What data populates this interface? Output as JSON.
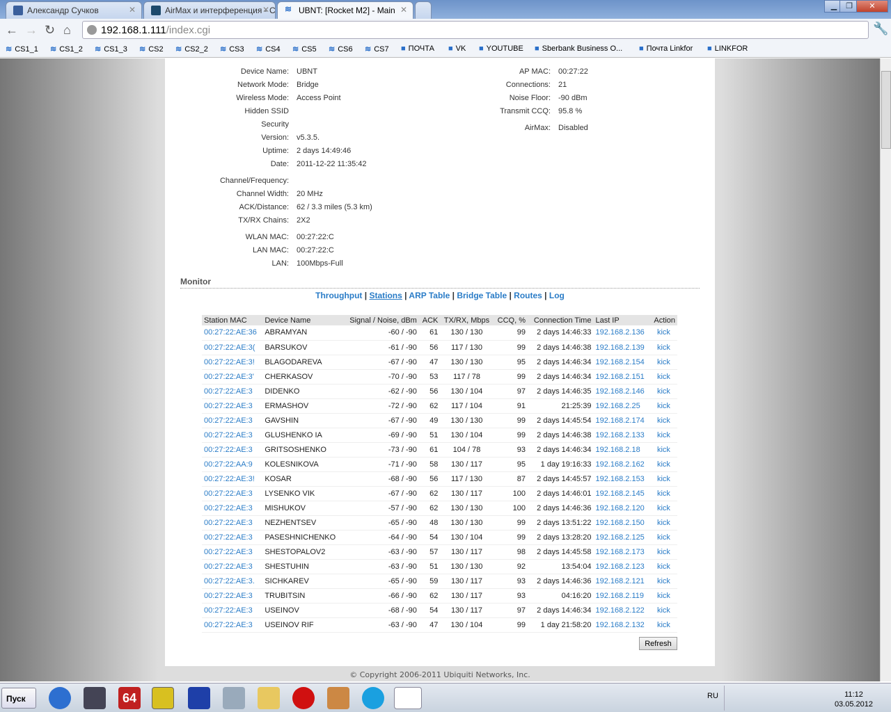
{
  "browser": {
    "tabs": [
      {
        "label": "Александр Сучков"
      },
      {
        "label": "AirMax и интерференция - Ст"
      },
      {
        "label": "UBNT: [Rocket M2] - Main"
      }
    ],
    "url_host": "192.168.1.111",
    "url_path": "/index.cgi",
    "bookmarks": [
      "CS1_1",
      "CS1_2",
      "CS1_3",
      "CS2",
      "CS2_2",
      "CS3",
      "CS4",
      "CS5",
      "CS6",
      "CS7",
      "ПОЧТА",
      "VK",
      "YOUTUBE",
      "Sberbank Business O...",
      "Почта Linkfor",
      "LINKFOR"
    ]
  },
  "info_left": [
    {
      "label": "Device Name:",
      "value": "UBNT"
    },
    {
      "label": "Network Mode:",
      "value": "Bridge"
    },
    {
      "label": "Wireless Mode:",
      "value": "Access Point"
    },
    {
      "label": "Hidden SSID",
      "value": ""
    },
    {
      "label": "Security",
      "value": ""
    },
    {
      "label": "Version:",
      "value": "v5.3.5."
    },
    {
      "label": "Uptime:",
      "value": "2 days 14:49:46"
    },
    {
      "label": "Date:",
      "value": "2011-12-22 11:35:42"
    },
    {
      "label": "Channel/Frequency:",
      "value": ""
    },
    {
      "label": "Channel Width:",
      "value": "20 MHz"
    },
    {
      "label": "ACK/Distance:",
      "value": "62 / 3.3 miles (5.3 km)"
    },
    {
      "label": "TX/RX Chains:",
      "value": "2X2"
    },
    {
      "label": "WLAN MAC:",
      "value": "00:27:22:C"
    },
    {
      "label": "LAN MAC:",
      "value": "00:27:22:C"
    },
    {
      "label": "LAN:",
      "value": "100Mbps-Full"
    }
  ],
  "info_right": [
    {
      "label": "AP MAC:",
      "value": "00:27:22"
    },
    {
      "label": "Connections:",
      "value": "21"
    },
    {
      "label": "Noise Floor:",
      "value": "-90 dBm"
    },
    {
      "label": "Transmit CCQ:",
      "value": "95.8 %"
    },
    {
      "label": "AirMax:",
      "value": "Disabled"
    }
  ],
  "monitor": {
    "title": "Monitor",
    "links": [
      "Throughput",
      "Stations",
      "ARP Table",
      "Bridge Table",
      "Routes",
      "Log"
    ]
  },
  "table": {
    "headers": [
      "Station MAC",
      "Device Name",
      "Signal / Noise, dBm",
      "ACK",
      "TX/RX, Mbps",
      "CCQ, %",
      "Connection Time",
      "Last IP",
      "Action"
    ],
    "rows": [
      [
        "00:27:22:AE:36",
        "ABRAMYAN",
        "-60 / -90",
        "61",
        "130 / 130",
        "99",
        "2 days 14:46:33",
        "192.168.2.136",
        "kick"
      ],
      [
        "00:27:22:AE:3(",
        "BARSUKOV",
        "-61 / -90",
        "56",
        "117 / 130",
        "99",
        "2 days 14:46:38",
        "192.168.2.139",
        "kick"
      ],
      [
        "00:27:22:AE:3!",
        "BLAGODAREVA",
        "-67 / -90",
        "47",
        "130 / 130",
        "95",
        "2 days 14:46:34",
        "192.168.2.154",
        "kick"
      ],
      [
        "00:27:22:AE:3'",
        "CHERKASOV",
        "-70 / -90",
        "53",
        "117 / 78",
        "99",
        "2 days 14:46:34",
        "192.168.2.151",
        "kick"
      ],
      [
        "00:27:22:AE:3",
        "DIDENKO",
        "-62 / -90",
        "56",
        "130 / 104",
        "97",
        "2 days 14:46:35",
        "192.168.2.146",
        "kick"
      ],
      [
        "00:27:22:AE:3",
        "ERMASHOV",
        "-72 / -90",
        "62",
        "117 / 104",
        "91",
        "21:25:39",
        "192.168.2.25",
        "kick"
      ],
      [
        "00:27:22:AE:3",
        "GAVSHIN",
        "-67 / -90",
        "49",
        "130 / 130",
        "99",
        "2 days 14:45:54",
        "192.168.2.174",
        "kick"
      ],
      [
        "00:27:22:AE:3",
        "GLUSHENKO IA",
        "-69 / -90",
        "51",
        "130 / 104",
        "99",
        "2 days 14:46:38",
        "192.168.2.133",
        "kick"
      ],
      [
        "00:27:22:AE:3",
        "GRITSOSHENKO",
        "-73 / -90",
        "61",
        "104 / 78",
        "93",
        "2 days 14:46:34",
        "192.168.2.18",
        "kick"
      ],
      [
        "00:27:22:AA:9",
        "KOLESNIKOVA",
        "-71 / -90",
        "58",
        "130 / 117",
        "95",
        "1 day 19:16:33",
        "192.168.2.162",
        "kick"
      ],
      [
        "00:27:22:AE:3!",
        "KOSAR",
        "-68 / -90",
        "56",
        "117 / 130",
        "87",
        "2 days 14:45:57",
        "192.168.2.153",
        "kick"
      ],
      [
        "00:27:22:AE:3",
        "LYSENKO VIK",
        "-67 / -90",
        "62",
        "130 / 117",
        "100",
        "2 days 14:46:01",
        "192.168.2.145",
        "kick"
      ],
      [
        "00:27:22:AE:3",
        "MISHUKOV",
        "-57 / -90",
        "62",
        "130 / 130",
        "100",
        "2 days 14:46:36",
        "192.168.2.120",
        "kick"
      ],
      [
        "00:27:22:AE:3",
        "NEZHENTSEV",
        "-65 / -90",
        "48",
        "130 / 130",
        "99",
        "2 days 13:51:22",
        "192.168.2.150",
        "kick"
      ],
      [
        "00:27:22:AE:3",
        "PASESHNICHENKO",
        "-64 / -90",
        "54",
        "130 / 104",
        "99",
        "2 days 13:28:20",
        "192.168.2.125",
        "kick"
      ],
      [
        "00:27:22:AE:3",
        "SHESTOPALOV2",
        "-63 / -90",
        "57",
        "130 / 117",
        "98",
        "2 days 14:45:58",
        "192.168.2.173",
        "kick"
      ],
      [
        "00:27:22:AE:3",
        "SHESTUHIN",
        "-63 / -90",
        "51",
        "130 / 130",
        "92",
        "13:54:04",
        "192.168.2.123",
        "kick"
      ],
      [
        "00:27:22:AE:3.",
        "SICHKAREV",
        "-65 / -90",
        "59",
        "130 / 117",
        "93",
        "2 days 14:46:36",
        "192.168.2.121",
        "kick"
      ],
      [
        "00:27:22:AE:3",
        "TRUBITSIN",
        "-66 / -90",
        "62",
        "130 / 117",
        "93",
        "04:16:20",
        "192.168.2.119",
        "kick"
      ],
      [
        "00:27:22:AE:3",
        "USEINOV",
        "-68 / -90",
        "54",
        "130 / 117",
        "97",
        "2 days 14:46:34",
        "192.168.2.122",
        "kick"
      ],
      [
        "00:27:22:AE:3",
        "USEINOV RIF",
        "-63 / -90",
        "47",
        "130 / 104",
        "99",
        "1 day 21:58:20",
        "192.168.2.132",
        "kick"
      ]
    ]
  },
  "refresh_label": "Refresh",
  "copyright": "© Copyright 2006-2011 Ubiquiti Networks, Inc.",
  "taskbar": {
    "start": "Пуск",
    "lang": "RU",
    "time": "11:12",
    "date": "03.05.2012"
  }
}
